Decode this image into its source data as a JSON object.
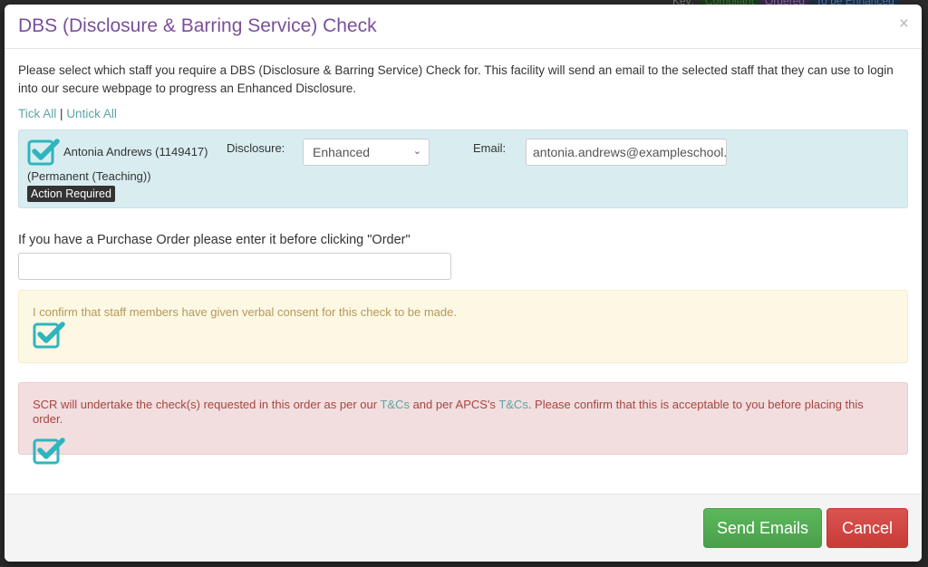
{
  "backdrop": {
    "key_label": "Key:",
    "key_items": [
      "Compliant",
      "Ordered",
      "To be Enhanced"
    ]
  },
  "modal": {
    "title": "DBS (Disclosure & Barring Service) Check",
    "close_icon": "×",
    "intro": "Please select which staff you require a DBS (Disclosure & Barring Service) Check for. This facility will send an email to the selected staff that they can use to login into our secure webpage to progress an Enhanced Disclosure.",
    "tick_all": "Tick All",
    "separator": "|",
    "untick_all": "Untick All",
    "staff": [
      {
        "checked": true,
        "name": "Antonia Andrews (1149417)",
        "role": "(Permanent (Teaching))",
        "badge": "Action Required",
        "disclosure_label": "Disclosure:",
        "disclosure_value": "Enhanced",
        "email_label": "Email:",
        "email_value": "antonia.andrews@exampleschool.c"
      }
    ],
    "purchase_order": {
      "label": "If you have a Purchase Order please enter it before clicking \"Order\"",
      "value": "",
      "placeholder": ""
    },
    "consent": {
      "text": "I confirm that staff members have given verbal consent for this check to be made.",
      "checked": true
    },
    "terms": {
      "text_1": "SCR will undertake the check(s) requested in this order as per our ",
      "link_1": "T&Cs",
      "text_2": " and per APCS's ",
      "link_2": "T&Cs",
      "text_3": ". Please confirm that this is acceptable to you before placing this order.",
      "checked": true
    },
    "footer": {
      "send_label": "Send Emails",
      "cancel_label": "Cancel"
    }
  },
  "colors": {
    "title": "#7a4f9a",
    "check": "#2fb5bd",
    "send": "#5cb85c",
    "cancel": "#d9534f",
    "link": "#5ea3a8"
  }
}
